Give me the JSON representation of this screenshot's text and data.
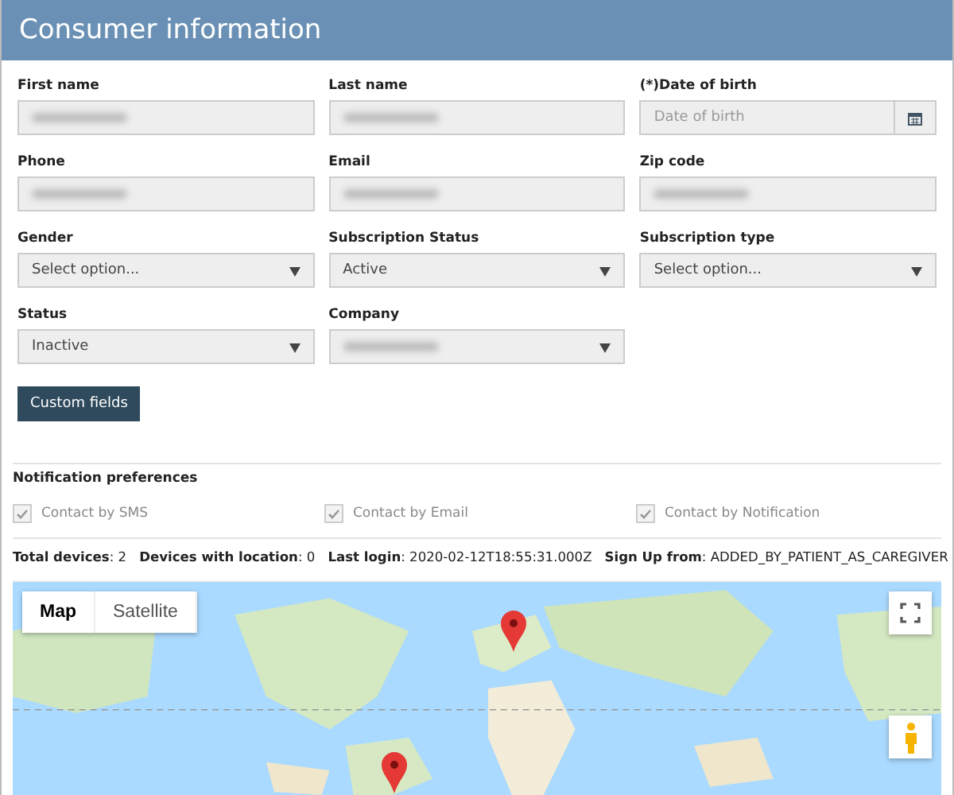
{
  "header": {
    "title": "Consumer information"
  },
  "fields": [
    {
      "kind": "text",
      "label": "First name",
      "redacted": true
    },
    {
      "kind": "text",
      "label": "Last name",
      "redacted": true
    },
    {
      "kind": "date",
      "label": "(*)Date of birth",
      "placeholder": "Date of birth"
    },
    {
      "kind": "text",
      "label": "Phone",
      "redacted": true
    },
    {
      "kind": "text",
      "label": "Email",
      "redacted": true
    },
    {
      "kind": "text",
      "label": "Zip code",
      "redacted": true
    },
    {
      "kind": "select",
      "label": "Gender",
      "value": "Select option..."
    },
    {
      "kind": "select",
      "label": "Subscription Status",
      "value": "Active"
    },
    {
      "kind": "select",
      "label": "Subscription type",
      "value": "Select option..."
    },
    {
      "kind": "select",
      "label": "Status",
      "value": "Inactive"
    },
    {
      "kind": "select",
      "label": "Company",
      "redacted": true
    }
  ],
  "custom_fields_button": "Custom fields",
  "notifications": {
    "title": "Notification preferences",
    "options": [
      {
        "label": "Contact by SMS",
        "checked": true
      },
      {
        "label": "Contact by Email",
        "checked": true
      },
      {
        "label": "Contact by Notification",
        "checked": true
      }
    ]
  },
  "stats": [
    "**Total devices**: 2",
    "**Devices with location**: 0",
    "**Last login**: 2020-02-12T18:55:31.000Z",
    "**Sign Up from**: ADDED_BY_PATIENT_AS_CAREGIVER"
  ],
  "map": {
    "types": [
      {
        "label": "Map",
        "selected": true
      },
      {
        "label": "Satellite",
        "selected": false
      }
    ]
  }
}
